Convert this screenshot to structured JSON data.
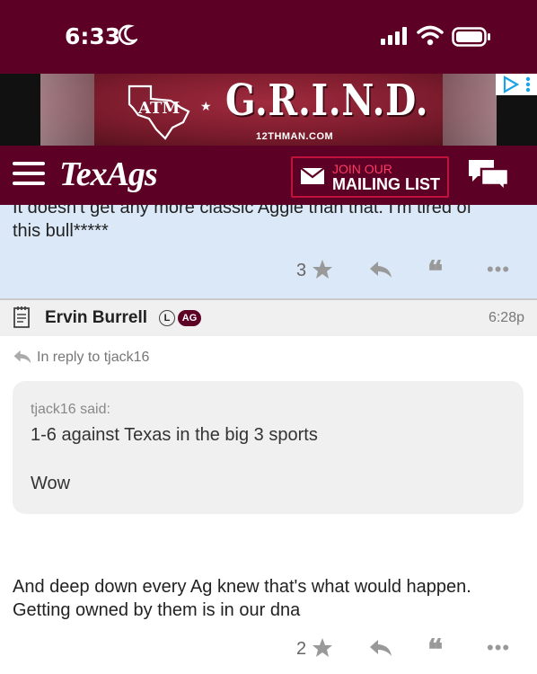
{
  "status_bar": {
    "time": "6:33"
  },
  "ad": {
    "brand_text": "G.R.I.N.D.",
    "logo_text": "ATM",
    "url_text": "12THMAN.COM"
  },
  "nav": {
    "brand": "TexAgs",
    "mail_line1": "JOIN OUR",
    "mail_line2": "MAILING LIST"
  },
  "previous_post": {
    "line1": "It doesn't get any more classic Aggie than that. I'm tired of",
    "line2": "this bull*****",
    "star_count": "3"
  },
  "post": {
    "author": "Ervin Burrell",
    "badge_l": "L",
    "badge_ag": "AG",
    "time": "6:28p",
    "in_reply": "In reply to tjack16",
    "quote_author": "tjack16 said:",
    "quote_line1": "1-6 against Texas in the big 3 sports",
    "quote_line2": "Wow",
    "body_line1": "And deep down every Ag knew that's what would happen.",
    "body_line2": "Getting owned by them is in our dna",
    "star_count": "2"
  },
  "icons": {
    "more": "•••",
    "quote": "❝"
  },
  "colors": {
    "maroon": "#5d0025",
    "highlight": "#dbe8f8",
    "accent_red": "#c0123a"
  }
}
